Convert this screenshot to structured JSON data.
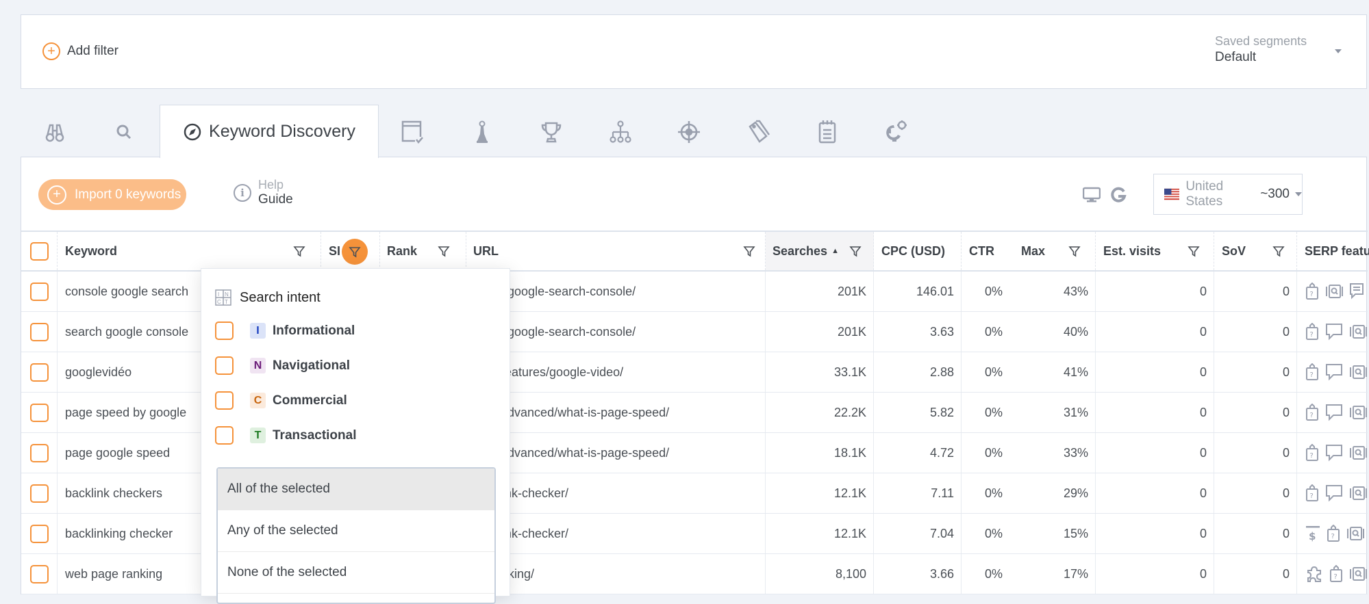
{
  "filter_bar": {
    "add_filter_label": "Add filter",
    "saved_segments_label": "Saved segments",
    "saved_segments_value": "Default"
  },
  "tabs": {
    "icons": [
      "binoculars-icon",
      "search-icon",
      "compass-icon",
      "browser-check-icon",
      "chess-pawn-icon",
      "trophy-icon",
      "sitemap-icon",
      "target-icon",
      "tags-icon",
      "notepad-icon",
      "gears-icon"
    ],
    "active_label": "Keyword Discovery"
  },
  "toolbar": {
    "import_label": "Import 0 keywords",
    "help_top": "Help",
    "help_bottom": "Guide",
    "country": "United States",
    "country_count": "~300"
  },
  "table": {
    "headers": {
      "keyword": "Keyword",
      "si": "SI",
      "rank": "Rank",
      "url": "URL",
      "searches": "Searches",
      "cpc": "CPC (USD)",
      "ctr": "CTR",
      "max": "Max",
      "est_visits": "Est. visits",
      "sov": "SoV",
      "serp": "SERP featu"
    },
    "sort": {
      "column": "searches",
      "direction": "ascending"
    },
    "rows": [
      {
        "keyword": "console google search",
        "url": "ration/google-search-console/",
        "searches": "201K",
        "cpc": "146.01",
        "ctr": "0%",
        "max": "43%",
        "est_visits": "0",
        "sov": "0",
        "serp": [
          "question-clipboard-icon",
          "image-search-icon",
          "comment-lines-icon"
        ]
      },
      {
        "keyword": "search google console",
        "url": "ration/google-search-console/",
        "searches": "201K",
        "cpc": "3.63",
        "ctr": "0%",
        "max": "40%",
        "est_visits": "0",
        "sov": "0",
        "serp": [
          "question-clipboard-icon",
          "speech-bubble-icon",
          "image-search-icon"
        ]
      },
      {
        "keyword": "googlevidéo",
        "url": "serp-features/google-video/",
        "searches": "33.1K",
        "cpc": "2.88",
        "ctr": "0%",
        "max": "41%",
        "est_visits": "0",
        "sov": "0",
        "serp": [
          "question-clipboard-icon",
          "speech-bubble-icon",
          "image-search-icon"
        ]
      },
      {
        "keyword": "page speed by google",
        "url": "-seo/advanced/what-is-page-speed/",
        "searches": "22.2K",
        "cpc": "5.82",
        "ctr": "0%",
        "max": "31%",
        "est_visits": "0",
        "sov": "0",
        "serp": [
          "question-clipboard-icon",
          "speech-bubble-icon",
          "image-search-icon"
        ]
      },
      {
        "keyword": "page google speed",
        "url": "-seo/advanced/what-is-page-speed/",
        "searches": "18.1K",
        "cpc": "4.72",
        "ctr": "0%",
        "max": "33%",
        "est_visits": "0",
        "sov": "0",
        "serp": [
          "question-clipboard-icon",
          "speech-bubble-icon",
          "image-search-icon"
        ]
      },
      {
        "keyword": "backlink checkers",
        "url": "backlink-checker/",
        "searches": "12.1K",
        "cpc": "7.11",
        "ctr": "0%",
        "max": "29%",
        "est_visits": "0",
        "sov": "0",
        "serp": [
          "question-clipboard-icon",
          "speech-bubble-icon",
          "image-search-icon"
        ]
      },
      {
        "keyword": "backlinking checker",
        "url": "backlink-checker/",
        "searches": "12.1K",
        "cpc": "7.04",
        "ctr": "0%",
        "max": "15%",
        "est_visits": "0",
        "sov": "0",
        "serp": [
          "top-ad-dollar-icon",
          "question-clipboard-icon",
          "image-search-icon"
        ]
      },
      {
        "keyword": "web page ranking",
        "url": "ite-ranking/",
        "searches": "8,100",
        "cpc": "3.66",
        "ctr": "0%",
        "max": "17%",
        "est_visits": "0",
        "sov": "0",
        "serp": [
          "puzzle-icon",
          "question-clipboard-icon",
          "image-search-icon"
        ]
      }
    ]
  },
  "search_intent_dropdown": {
    "title": "Search intent",
    "options": [
      {
        "letter": "I",
        "label": "Informational",
        "color": "#1a3fbf",
        "bg": "#dbe3f8",
        "checked": false
      },
      {
        "letter": "N",
        "label": "Navigational",
        "color": "#6a1a78",
        "bg": "#f0e4f2",
        "checked": false
      },
      {
        "letter": "C",
        "label": "Commercial",
        "color": "#c8660f",
        "bg": "#fbeadc",
        "checked": false
      },
      {
        "letter": "T",
        "label": "Transactional",
        "color": "#1d7a22",
        "bg": "#dff0df",
        "checked": false
      }
    ],
    "match_modes": [
      "All of the selected",
      "Any of the selected",
      "None of the selected"
    ],
    "selected_match_mode": "All of the selected"
  },
  "colors": {
    "accent": "#f5923a",
    "accent_light": "#fbbd88",
    "icon_gray": "#9aa0ae",
    "background": "#f0f3f8"
  }
}
